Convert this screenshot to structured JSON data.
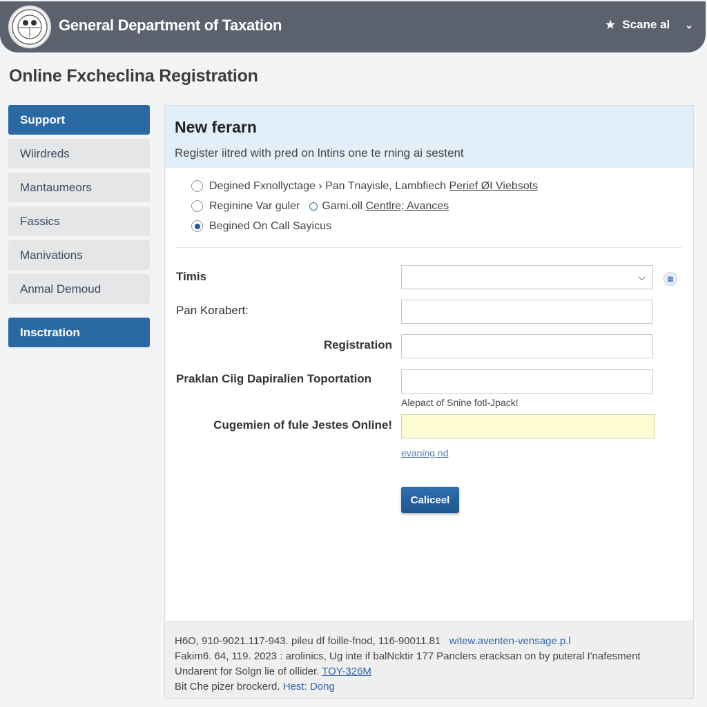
{
  "header": {
    "app_title": "General Department of Taxation",
    "logo": "department-seal-logo",
    "user_menu": {
      "label": "Scane al",
      "icon": "star-badge-icon",
      "chevron": "chevron-down-icon"
    }
  },
  "page": {
    "title": "Online Fxcheclina Registration"
  },
  "sidebar": {
    "items": [
      {
        "label": "Support",
        "active": true
      },
      {
        "label": "Wiirdreds",
        "active": false
      },
      {
        "label": "Mantaumeors",
        "active": false
      },
      {
        "label": "Fassics",
        "active": false
      },
      {
        "label": "Manivations",
        "active": false
      },
      {
        "label": "Anmal Demoud",
        "active": false
      },
      {
        "label": "Insctration",
        "active": true
      }
    ]
  },
  "panel": {
    "title": "New ferarn",
    "subtitle": "Register iitred with pred on lntins one te rning ai sestent",
    "options": [
      {
        "label": "Degined Fxnollyctage",
        "extra": "› Pan Tnayisle, Lambfiech",
        "link": "Perief ØI Viebsots",
        "checked": false
      },
      {
        "label": "Reginine Var guler",
        "extra": "Gami.oll",
        "link": "Centlre; Avances",
        "checked": false
      },
      {
        "label": "Begined On Call Sayicus",
        "checked": true
      }
    ],
    "form": {
      "fields": [
        {
          "label": "Timis",
          "type": "select",
          "value": "",
          "info_icon": "info-grid-icon"
        },
        {
          "label": "Pan Korabert:",
          "type": "text",
          "value": ""
        },
        {
          "label": "Registration",
          "type": "text",
          "value": ""
        },
        {
          "label": "Praklan Ciig Dapiralien Toportation",
          "type": "text",
          "value": "",
          "hint": "Alepact of Snine fotl-Jpack!"
        },
        {
          "label": "Cugemien of fule Jestes Online!",
          "type": "text",
          "value": "",
          "highlight": true,
          "link": "evaning nd"
        }
      ],
      "submit_label": "Caliceel"
    },
    "footer": {
      "line1": "H6O, 910-9021.117-943. pileu df  foille-fnod, 116-90011.81",
      "line1_link": "witew.aventen-vensage.p.l",
      "line2": "Fakim6. 64, 119. 2023 : arolinics, Ug inte if balNcktir 177 Panclers eracksan on by puteral I'nafesment",
      "line3": "Undarent for Solgn lie of ollider.",
      "line3_link": "TOY-326M",
      "line4": "Bit Che pizer brockerd.",
      "line4_link": "Hest: Dong"
    }
  }
}
